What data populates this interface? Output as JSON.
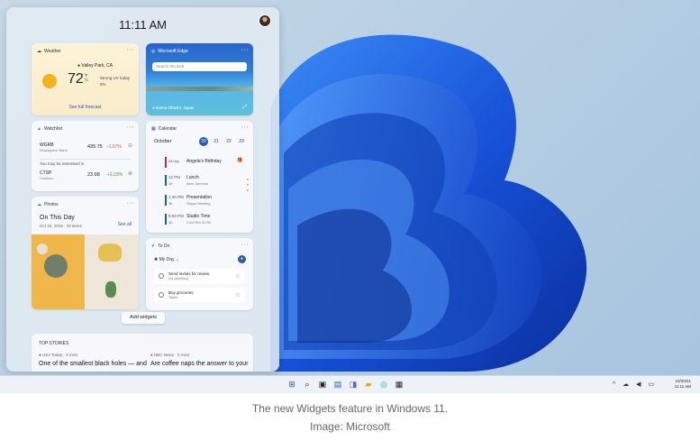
{
  "board": {
    "clock": "11:11 AM",
    "weather": {
      "title": "Weather",
      "location": "Valley Park, CA",
      "temperature": "72",
      "unit_f": "°F",
      "unit_c": "°C",
      "detail1": "Strong UV today",
      "detail2": "0%",
      "link": "See full forecast"
    },
    "edge": {
      "title": "Microsoft Edge",
      "search_placeholder": "Search the web",
      "caption": "Ikema Ohashi, Japan"
    },
    "watchlist": {
      "title": "Watchlist",
      "stocks": [
        {
          "ticker": "WGRB",
          "name": "Woodgrove Bank",
          "price": "435.75",
          "change": "-1.67%",
          "change_color": "#d9534f"
        },
        {
          "ticker": "CTSP",
          "name": "Contoso",
          "price": "23.98",
          "change": "+2.23%",
          "change_color": "#2e9a4a"
        }
      ],
      "interest": "You may be interested in"
    },
    "calendar": {
      "title": "Calendar",
      "month": "October",
      "days": [
        "20",
        "21",
        "22",
        "23"
      ],
      "events": [
        {
          "time": "All day",
          "name": "Angela's Birthday",
          "sub": ""
        },
        {
          "time": "12 PM",
          "name": "Lunch",
          "sub": "Alex Johnson"
        },
        {
          "time": "1:30 PM",
          "name": "Presentation",
          "sub": "Skype Meeting"
        },
        {
          "time": "6:00 PM",
          "name": "Studio Time",
          "sub": "Conf Rm 32/35"
        }
      ],
      "durations": [
        "",
        "1h",
        "1h",
        "1h"
      ],
      "icon_gift": "🎁"
    },
    "photos": {
      "title": "Photos",
      "heading": "On This Day",
      "date": "Oct 20, 2019 · 33 items",
      "see_all": "See all"
    },
    "todo": {
      "title": "To Do",
      "list": "My Day",
      "tasks": [
        {
          "title": "Send invites for review",
          "sub": "Q4 planning"
        },
        {
          "title": "Buy groceries",
          "sub": "Tasks"
        }
      ]
    },
    "add_widgets": "Add widgets",
    "top_stories": {
      "title": "TOP STORIES",
      "items": [
        {
          "source": "USA Today · 3 mins",
          "headline": "One of the smallest black holes — and"
        },
        {
          "source": "NBC News · 5 mins",
          "headline": "Are coffee naps the answer to your"
        }
      ]
    },
    "more_label": "···"
  },
  "taskbar": {
    "tray_icons": "^ ☁ ◀ ▭",
    "date": "10/20/21",
    "time": "11:11 AM"
  },
  "caption": {
    "line1": "The new Widgets feature in Windows 11.",
    "line2": "Image: Microsoft"
  },
  "colors": {
    "accent": "#1f5bb5",
    "bloom": "#1a5fe0"
  },
  "icons": [
    "weather-icon",
    "edge-icon",
    "watchlist-icon",
    "calendar-icon",
    "photos-icon",
    "todo-icon",
    "start-icon",
    "search-icon",
    "taskview-icon",
    "file-explorer-icon",
    "edge-taskbar-icon",
    "store-icon"
  ]
}
